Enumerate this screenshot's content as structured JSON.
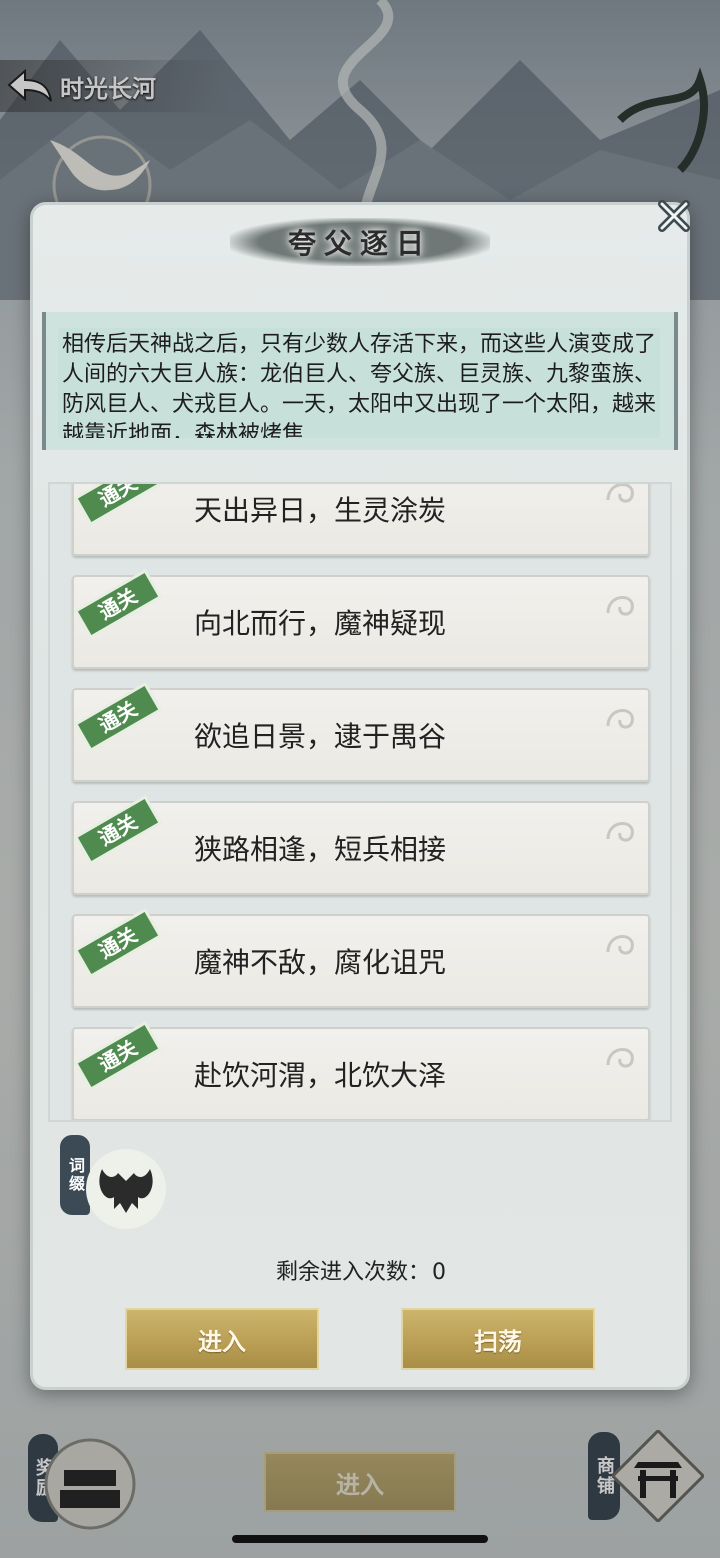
{
  "header": {
    "title": "时光长河"
  },
  "modal": {
    "title": "夸父逐日",
    "story": "相传后天神战之后，只有少数人存活下来，而这些人演变成了人间的六大巨人族：龙伯巨人、夸父族、巨灵族、九黎蛮族、防风巨人、犬戎巨人。一天，太阳中又出现了一个太阳，越来越靠近地面，森林被烤焦",
    "stages": [
      {
        "name": "天出异日，生灵涂炭",
        "badge": "通关"
      },
      {
        "name": "向北而行，魔神疑现",
        "badge": "通关"
      },
      {
        "name": "欲追日景，逮于禺谷",
        "badge": "通关"
      },
      {
        "name": "狭路相逢，短兵相接",
        "badge": "通关"
      },
      {
        "name": "魔神不敌，腐化诅咒",
        "badge": "通关"
      },
      {
        "name": "赴饮河渭，北饮大泽",
        "badge": "通关"
      }
    ],
    "affix_label": "词缀",
    "remaining_label": "剩余进入次数：",
    "remaining_value": "0",
    "enter_label": "进入",
    "sweep_label": "扫荡"
  },
  "bottom": {
    "reward_label": "奖励",
    "enter_label": "进入",
    "shop_label": "商铺"
  },
  "colors": {
    "accent_gold": "#b99d53",
    "badge_green": "#4f8a4f",
    "label_slate": "#3b4a55"
  }
}
